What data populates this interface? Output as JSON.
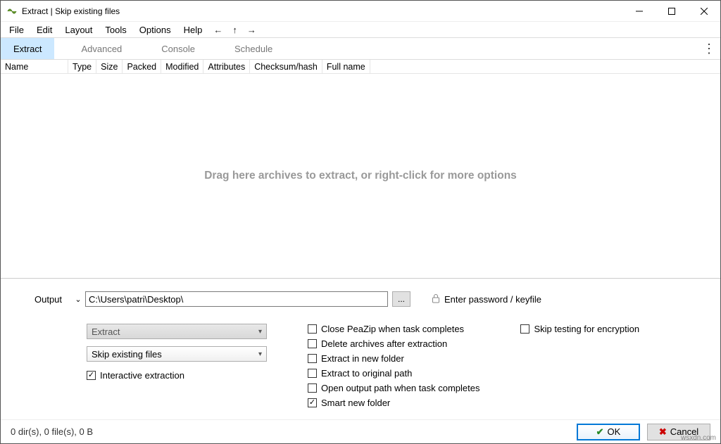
{
  "title": "Extract | Skip existing files",
  "menubar": [
    "File",
    "Edit",
    "Layout",
    "Tools",
    "Options",
    "Help"
  ],
  "tabs": [
    "Extract",
    "Advanced",
    "Console",
    "Schedule"
  ],
  "columns": [
    "Name",
    "Type",
    "Size",
    "Packed",
    "Modified",
    "Attributes",
    "Checksum/hash",
    "Full name"
  ],
  "drag_hint": "Drag here archives to extract, or right-click for more options",
  "output": {
    "label": "Output",
    "path": "C:\\Users\\patri\\Desktop\\",
    "browse": "...",
    "password": "Enter password / keyfile"
  },
  "selects": {
    "mode": "Extract",
    "existing": "Skip existing files"
  },
  "checks": {
    "interactive": "Interactive extraction",
    "close_peazip": "Close PeaZip when task completes",
    "delete_after": "Delete archives after extraction",
    "new_folder": "Extract in new folder",
    "original_path": "Extract to original path",
    "open_output": "Open output path when task completes",
    "smart_folder": "Smart new folder",
    "skip_testing": "Skip testing for encryption"
  },
  "buttons": {
    "ok": "OK",
    "cancel": "Cancel"
  },
  "status": "0 dir(s), 0 file(s), 0 B",
  "watermark": "wsxdn.com"
}
